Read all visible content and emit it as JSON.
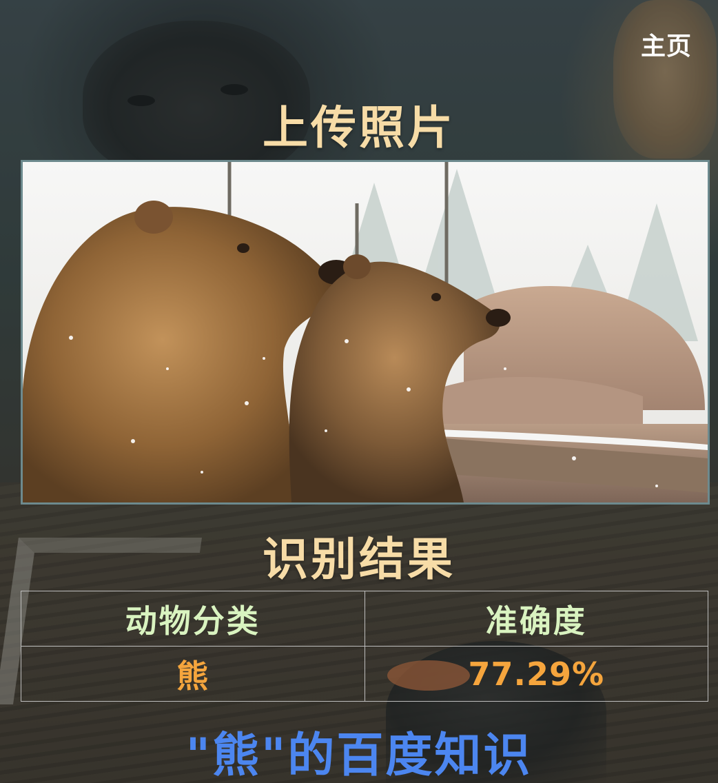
{
  "nav": {
    "home_label": "主页"
  },
  "upload": {
    "title": "上传照片"
  },
  "result": {
    "title": "识别结果",
    "headers": [
      "动物分类",
      "准确度"
    ],
    "rows": [
      {
        "category": "熊",
        "accuracy": "77.29%"
      }
    ]
  },
  "baike": {
    "title": "\"熊\"的百度知识"
  },
  "colors": {
    "title": "#f7dca7",
    "table_header": "#d9f3c0",
    "table_value": "#f5a53d",
    "baike_link": "#4c86f0",
    "photo_border": "#6d8a8e"
  }
}
